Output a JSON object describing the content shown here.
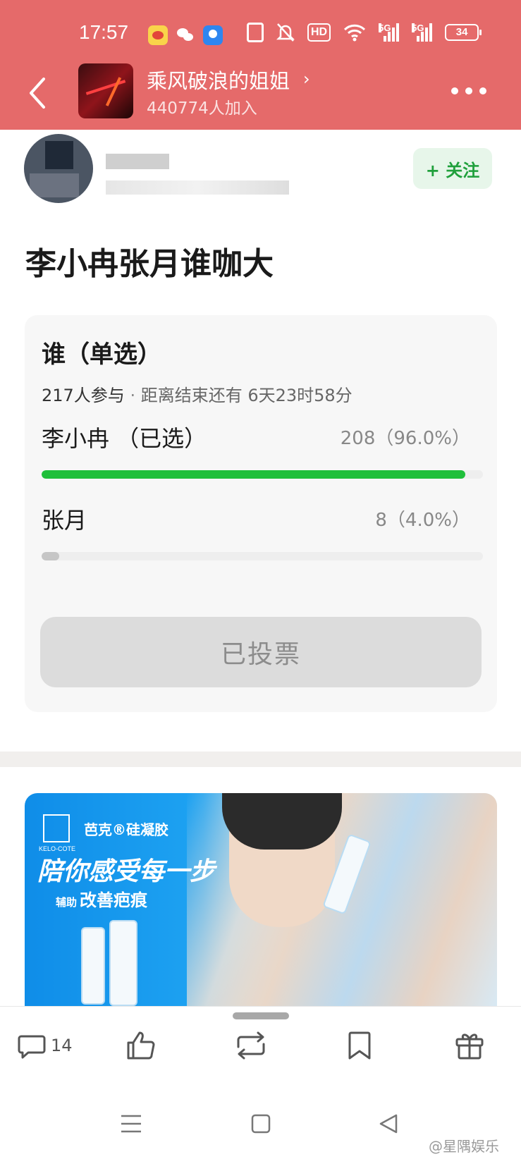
{
  "status_bar": {
    "time": "17:57",
    "hd_label": "HD",
    "signal1_label": "5G",
    "signal2_label": "5G",
    "battery": "34"
  },
  "nav": {
    "group_title": "乘风破浪的姐姐",
    "members": "440774人加入"
  },
  "post": {
    "follow_label": "+ 关注",
    "title": "李小冉张月谁咖大"
  },
  "poll": {
    "title": "谁（单选）",
    "participants": "217人参与",
    "separator": " · ",
    "remaining": "距离结束还有 6天23时58分",
    "options": [
      {
        "label": "李小冉 （已选）",
        "count": "208（96.0%）",
        "percent": 96.0,
        "selected": true
      },
      {
        "label": "张月",
        "count": "8（4.0%）",
        "percent": 4.0,
        "selected": false
      }
    ],
    "button_label": "已投票",
    "selected_color": "#1fbf3b",
    "unselected_color": "#c6c6c6"
  },
  "ad": {
    "logo_text": "KELO-COTE",
    "brand": "芭克®硅凝胶",
    "headline": "陪你感受每一步",
    "sub_small": "辅助",
    "sub_main": "改善疤痕"
  },
  "actions": {
    "comment_count": "14"
  },
  "watermark": "@星隅娱乐",
  "colors": {
    "header_bg": "#e56a6a",
    "follow_green": "#20a03c"
  }
}
